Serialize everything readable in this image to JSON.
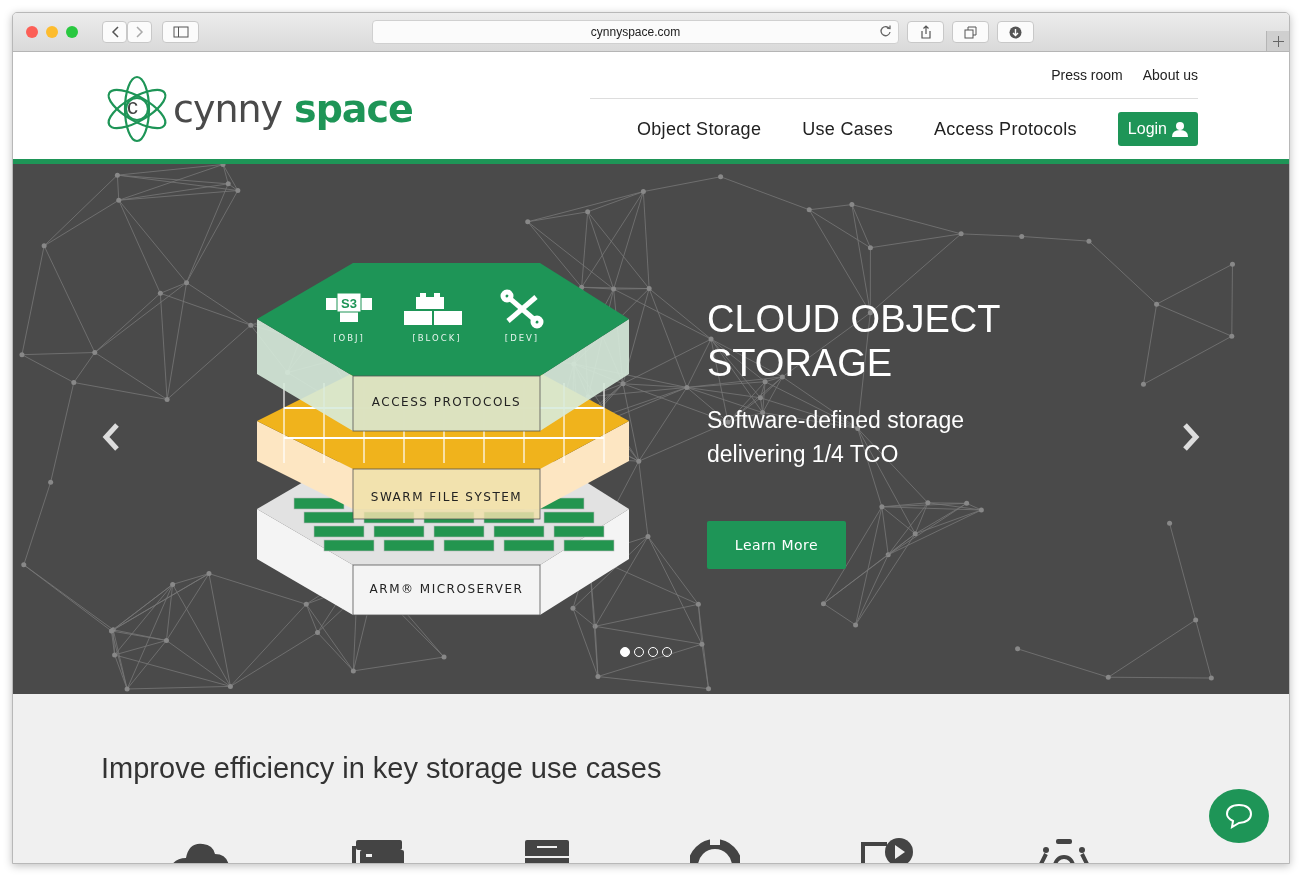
{
  "browser": {
    "url": "cynnyspace.com"
  },
  "header": {
    "logo": {
      "mark_letter": "c",
      "word_1": "cynny",
      "word_2": "space"
    },
    "top_links": [
      {
        "label": "Press room"
      },
      {
        "label": "About us"
      }
    ],
    "nav": [
      {
        "label": "Object Storage"
      },
      {
        "label": "Use Cases"
      },
      {
        "label": "Access Protocols"
      }
    ],
    "login": {
      "label": "Login"
    }
  },
  "hero": {
    "title": "CLOUD OBJECT STORAGE",
    "subtitle": "Software-defined storage delivering 1/4 TCO",
    "button": "Learn More",
    "illustration": {
      "s3_label": "S3",
      "icon_labels": [
        "[OBJ]",
        "[BLOCK]",
        "[DEV]"
      ],
      "layers": [
        "ACCESS PROTOCOLS",
        "SWARM FILE SYSTEM",
        "ARM® MICROSERVER"
      ]
    },
    "slides": [
      {
        "selected": true
      },
      {
        "selected": false
      },
      {
        "selected": false
      },
      {
        "selected": false
      }
    ]
  },
  "section": {
    "heading": "Improve efficiency in key storage use cases"
  }
}
